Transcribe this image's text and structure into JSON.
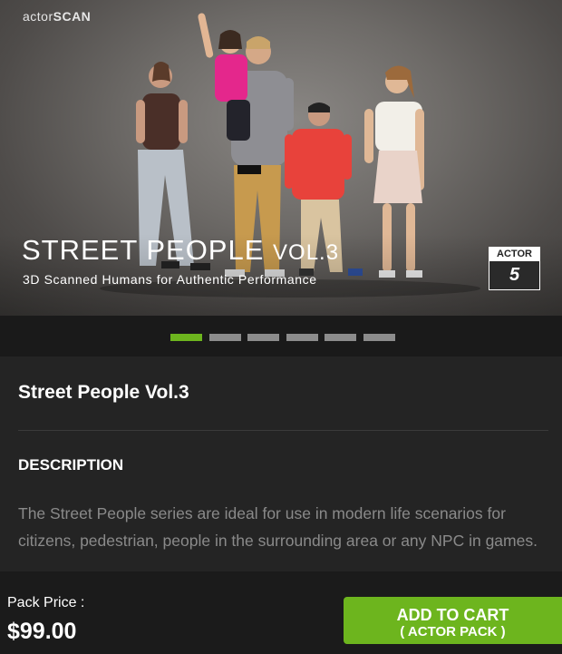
{
  "hero": {
    "brand_prefix": "actor",
    "brand_suffix": "SCAN",
    "title": "STREET PEOPLE VOL.3",
    "subtitle": "3D Scanned Humans for Authentic Performance",
    "badge_label": "ACTOR",
    "badge_value": "5"
  },
  "carousel": {
    "slide_count": 6,
    "active_index": 0,
    "colors": {
      "active": "#6db51e",
      "inactive": "#8c8c8c"
    }
  },
  "product": {
    "name": "Street People Vol.3",
    "description_heading": "DESCRIPTION",
    "description": "The Street People series are ideal for use in modern life scenarios for citizens, pedestrian, people in the surrounding area or any NPC in games."
  },
  "purchase": {
    "price_label": "Pack Price :",
    "price": "$99.00",
    "cart_line1": "ADD TO CART",
    "cart_line2": "( ACTOR PACK )",
    "accent_color": "#6db51e"
  }
}
